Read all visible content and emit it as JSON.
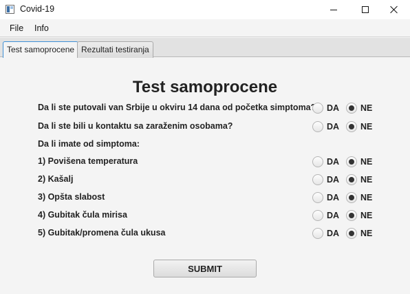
{
  "window": {
    "title": "Covid-19",
    "icon": "java-app-icon",
    "controls": [
      "minimize-icon",
      "maximize-icon",
      "close-icon"
    ]
  },
  "menu": {
    "file": "File",
    "info": "Info"
  },
  "tabs": [
    {
      "label": "Test samoprocene",
      "selected": true
    },
    {
      "label": "Rezultati testiranja",
      "selected": false
    }
  ],
  "form": {
    "title": "Test samoprocene",
    "option_yes": "DA",
    "option_no": "NE",
    "symptoms_heading": "Da li imate od simptoma:",
    "questions": [
      {
        "text": "Da li ste putovali van Srbije u okviru 14 dana od početka simptoma?",
        "selected": "NE"
      },
      {
        "text": "Da li ste bili u kontaktu sa zaraženim osobama?",
        "selected": "NE"
      },
      {
        "text": "1) Povišena temperatura",
        "selected": "NE"
      },
      {
        "text": "2) Kašalj",
        "selected": "NE"
      },
      {
        "text": "3) Opšta slabost",
        "selected": "NE"
      },
      {
        "text": "4) Gubitak čula mirisa",
        "selected": "NE"
      },
      {
        "text": "5) Gubitak/promena čula ukusa",
        "selected": "NE"
      }
    ],
    "submit_label": "SUBMIT"
  },
  "colors": {
    "focus_accent": "#3d8fd6",
    "background": "#f4f4f4"
  }
}
